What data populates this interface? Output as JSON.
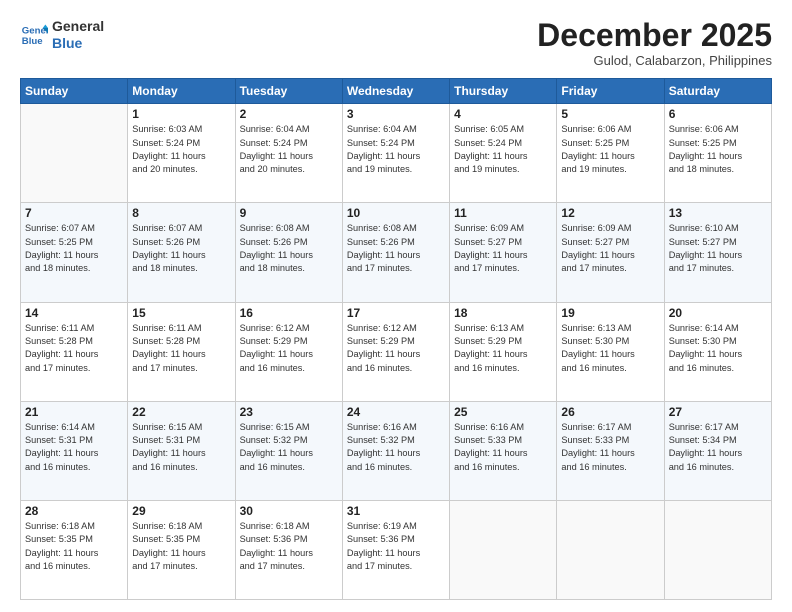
{
  "header": {
    "logo_line1": "General",
    "logo_line2": "Blue",
    "month": "December 2025",
    "location": "Gulod, Calabarzon, Philippines"
  },
  "weekdays": [
    "Sunday",
    "Monday",
    "Tuesday",
    "Wednesday",
    "Thursday",
    "Friday",
    "Saturday"
  ],
  "rows": [
    [
      {
        "day": "",
        "info": ""
      },
      {
        "day": "1",
        "info": "Sunrise: 6:03 AM\nSunset: 5:24 PM\nDaylight: 11 hours\nand 20 minutes."
      },
      {
        "day": "2",
        "info": "Sunrise: 6:04 AM\nSunset: 5:24 PM\nDaylight: 11 hours\nand 20 minutes."
      },
      {
        "day": "3",
        "info": "Sunrise: 6:04 AM\nSunset: 5:24 PM\nDaylight: 11 hours\nand 19 minutes."
      },
      {
        "day": "4",
        "info": "Sunrise: 6:05 AM\nSunset: 5:24 PM\nDaylight: 11 hours\nand 19 minutes."
      },
      {
        "day": "5",
        "info": "Sunrise: 6:06 AM\nSunset: 5:25 PM\nDaylight: 11 hours\nand 19 minutes."
      },
      {
        "day": "6",
        "info": "Sunrise: 6:06 AM\nSunset: 5:25 PM\nDaylight: 11 hours\nand 18 minutes."
      }
    ],
    [
      {
        "day": "7",
        "info": "Sunrise: 6:07 AM\nSunset: 5:25 PM\nDaylight: 11 hours\nand 18 minutes."
      },
      {
        "day": "8",
        "info": "Sunrise: 6:07 AM\nSunset: 5:26 PM\nDaylight: 11 hours\nand 18 minutes."
      },
      {
        "day": "9",
        "info": "Sunrise: 6:08 AM\nSunset: 5:26 PM\nDaylight: 11 hours\nand 18 minutes."
      },
      {
        "day": "10",
        "info": "Sunrise: 6:08 AM\nSunset: 5:26 PM\nDaylight: 11 hours\nand 17 minutes."
      },
      {
        "day": "11",
        "info": "Sunrise: 6:09 AM\nSunset: 5:27 PM\nDaylight: 11 hours\nand 17 minutes."
      },
      {
        "day": "12",
        "info": "Sunrise: 6:09 AM\nSunset: 5:27 PM\nDaylight: 11 hours\nand 17 minutes."
      },
      {
        "day": "13",
        "info": "Sunrise: 6:10 AM\nSunset: 5:27 PM\nDaylight: 11 hours\nand 17 minutes."
      }
    ],
    [
      {
        "day": "14",
        "info": "Sunrise: 6:11 AM\nSunset: 5:28 PM\nDaylight: 11 hours\nand 17 minutes."
      },
      {
        "day": "15",
        "info": "Sunrise: 6:11 AM\nSunset: 5:28 PM\nDaylight: 11 hours\nand 17 minutes."
      },
      {
        "day": "16",
        "info": "Sunrise: 6:12 AM\nSunset: 5:29 PM\nDaylight: 11 hours\nand 16 minutes."
      },
      {
        "day": "17",
        "info": "Sunrise: 6:12 AM\nSunset: 5:29 PM\nDaylight: 11 hours\nand 16 minutes."
      },
      {
        "day": "18",
        "info": "Sunrise: 6:13 AM\nSunset: 5:29 PM\nDaylight: 11 hours\nand 16 minutes."
      },
      {
        "day": "19",
        "info": "Sunrise: 6:13 AM\nSunset: 5:30 PM\nDaylight: 11 hours\nand 16 minutes."
      },
      {
        "day": "20",
        "info": "Sunrise: 6:14 AM\nSunset: 5:30 PM\nDaylight: 11 hours\nand 16 minutes."
      }
    ],
    [
      {
        "day": "21",
        "info": "Sunrise: 6:14 AM\nSunset: 5:31 PM\nDaylight: 11 hours\nand 16 minutes."
      },
      {
        "day": "22",
        "info": "Sunrise: 6:15 AM\nSunset: 5:31 PM\nDaylight: 11 hours\nand 16 minutes."
      },
      {
        "day": "23",
        "info": "Sunrise: 6:15 AM\nSunset: 5:32 PM\nDaylight: 11 hours\nand 16 minutes."
      },
      {
        "day": "24",
        "info": "Sunrise: 6:16 AM\nSunset: 5:32 PM\nDaylight: 11 hours\nand 16 minutes."
      },
      {
        "day": "25",
        "info": "Sunrise: 6:16 AM\nSunset: 5:33 PM\nDaylight: 11 hours\nand 16 minutes."
      },
      {
        "day": "26",
        "info": "Sunrise: 6:17 AM\nSunset: 5:33 PM\nDaylight: 11 hours\nand 16 minutes."
      },
      {
        "day": "27",
        "info": "Sunrise: 6:17 AM\nSunset: 5:34 PM\nDaylight: 11 hours\nand 16 minutes."
      }
    ],
    [
      {
        "day": "28",
        "info": "Sunrise: 6:18 AM\nSunset: 5:35 PM\nDaylight: 11 hours\nand 16 minutes."
      },
      {
        "day": "29",
        "info": "Sunrise: 6:18 AM\nSunset: 5:35 PM\nDaylight: 11 hours\nand 17 minutes."
      },
      {
        "day": "30",
        "info": "Sunrise: 6:18 AM\nSunset: 5:36 PM\nDaylight: 11 hours\nand 17 minutes."
      },
      {
        "day": "31",
        "info": "Sunrise: 6:19 AM\nSunset: 5:36 PM\nDaylight: 11 hours\nand 17 minutes."
      },
      {
        "day": "",
        "info": ""
      },
      {
        "day": "",
        "info": ""
      },
      {
        "day": "",
        "info": ""
      }
    ]
  ]
}
